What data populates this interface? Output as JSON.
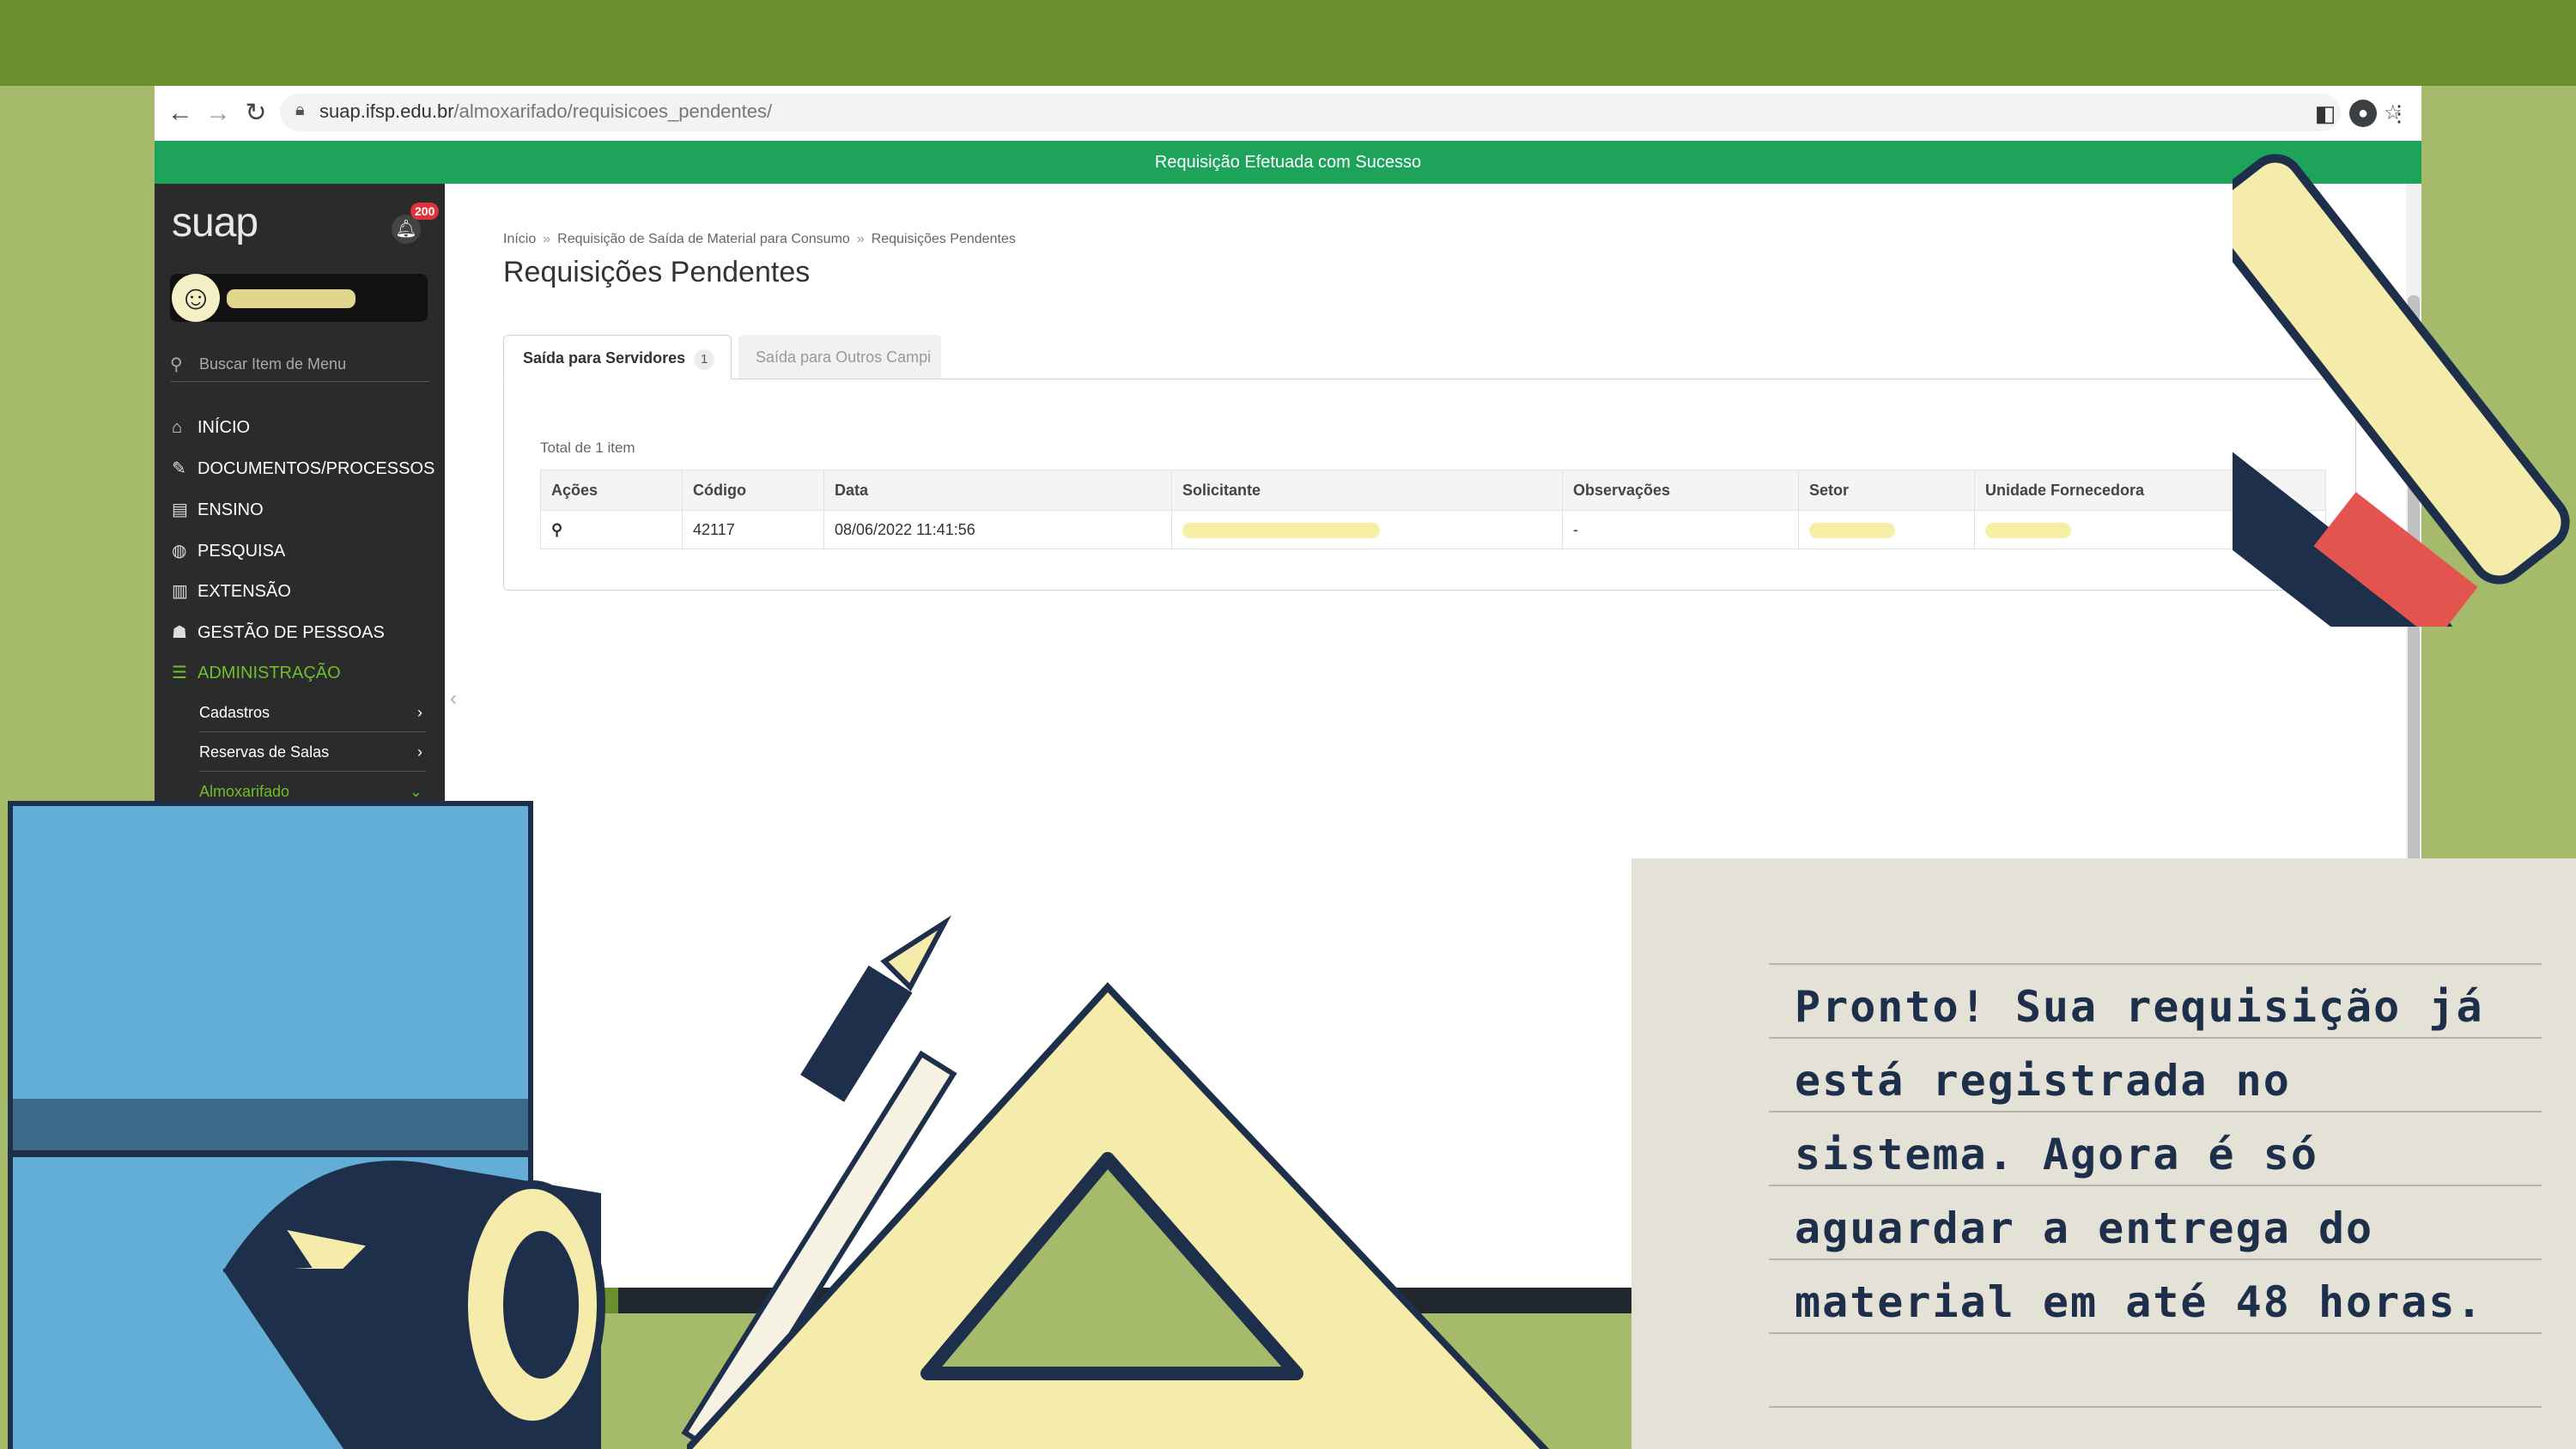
{
  "browser": {
    "url_domain": "suap.ifsp.edu.br",
    "url_path": "/almoxarifado/requisicoes_pendentes/",
    "icons": {
      "back": "arrow-left-icon",
      "forward": "arrow-right-icon",
      "reload": "reload-icon",
      "lock": "lock-icon",
      "share": "share-icon",
      "star": "star-icon",
      "side_panel": "side-panel-icon",
      "profile": "profile-icon",
      "menu": "kebab-menu-icon"
    }
  },
  "banner": {
    "message": "Requisição Efetuada com Sucesso",
    "color": "#1ea35b"
  },
  "sidebar": {
    "logo": "suap",
    "notifications_count": "200",
    "search_placeholder": "Buscar Item de Menu",
    "menu": [
      {
        "label": "INÍCIO",
        "icon": "home-icon"
      },
      {
        "label": "DOCUMENTOS/PROCESSOS",
        "icon": "document-icon"
      },
      {
        "label": "ENSINO",
        "icon": "ensino-icon"
      },
      {
        "label": "PESQUISA",
        "icon": "globe-icon"
      },
      {
        "label": "EXTENSÃO",
        "icon": "building-icon"
      },
      {
        "label": "GESTÃO DE PESSOAS",
        "icon": "people-icon"
      },
      {
        "label": "ADMINISTRAÇÃO",
        "icon": "list-icon"
      }
    ],
    "submenu": [
      {
        "label": "Cadastros"
      },
      {
        "label": "Reservas de Salas"
      },
      {
        "label": "Almoxarifado"
      }
    ],
    "accent": "#6fbf2b"
  },
  "main": {
    "breadcrumb": [
      "Início",
      "Requisição de Saída de Material para Consumo",
      "Requisições Pendentes"
    ],
    "title": "Requisições Pendentes",
    "tabs": [
      {
        "label": "Saída para Servidores",
        "count": "1"
      },
      {
        "label": "Saída para Outros Campi"
      }
    ],
    "total": "Total de 1 item",
    "table": {
      "columns": [
        "Ações",
        "Código",
        "Data",
        "Solicitante",
        "Observações",
        "Setor",
        "Unidade Fornecedora"
      ],
      "rows": [
        {
          "codigo": "42117",
          "data": "08/06/2022 11:41:56",
          "observacoes": "-"
        }
      ]
    }
  },
  "note": {
    "lines": [
      "Pronto! Sua requisição já",
      "está registrada no",
      "sistema. Agora é só",
      "aguardar a entrega do",
      "material em até 48 horas."
    ]
  },
  "colors": {
    "background": "#6b8f2c",
    "background_light": "#a6ba6c",
    "paper": "#e4e1d6",
    "ink": "#1d2f4a",
    "tape_blue": "#63aed6",
    "ruler": "#f5ebab",
    "marker_red": "#e4544f"
  }
}
